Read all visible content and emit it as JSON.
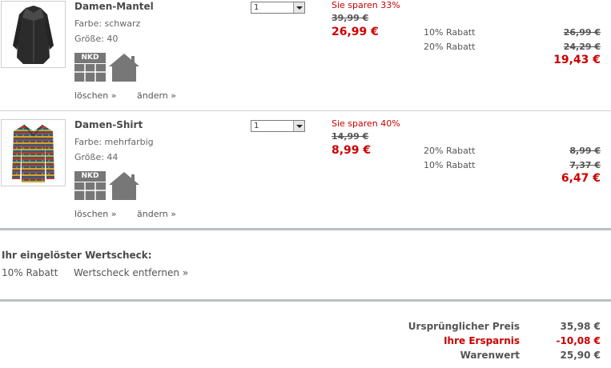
{
  "items": [
    {
      "name": "Damen-Mantel",
      "farbe": "Farbe: schwarz",
      "groesse": "Größe: 40",
      "qty": "1",
      "save_text": "Sie sparen 33%",
      "old_price": "39,99 €",
      "new_price": "26,99 €",
      "rabatte": [
        {
          "label": "10% Rabatt",
          "value": "26,99 €"
        },
        {
          "label": "20% Rabatt",
          "value": "24,29 €"
        }
      ],
      "final_price": "19,43 €",
      "nkd_label": "NKD",
      "delete_link": "löschen »",
      "change_link": "ändern »",
      "thumb_color": "#2e2e2e"
    },
    {
      "name": "Damen-Shirt",
      "farbe": "Farbe: mehrfarbig",
      "groesse": "Größe: 44",
      "qty": "1",
      "save_text": "Sie sparen 40%",
      "old_price": "14,99 €",
      "new_price": "8,99 €",
      "rabatte": [
        {
          "label": "20% Rabatt",
          "value": "8,99 €"
        },
        {
          "label": "10% Rabatt",
          "value": "7,37 €"
        }
      ],
      "final_price": "6,47 €",
      "nkd_label": "NKD",
      "delete_link": "löschen »",
      "change_link": "ändern »",
      "thumb_color": "#3a5a7a"
    }
  ],
  "voucher": {
    "heading": "Ihr eingelöster Wertscheck:",
    "value": "10% Rabatt",
    "remove_link": "Wertscheck entfernen »"
  },
  "summary": {
    "original_label": "Ursprünglicher Preis",
    "original_value": "35,98 €",
    "savings_label": "Ihre Ersparnis",
    "savings_value": "-10,08 €",
    "total_label": "Warenwert",
    "total_value": "25,90 €"
  },
  "colors": {
    "accent_red": "#cc0000",
    "text_gray": "#555555",
    "icon_gray": "#777777",
    "divider": "#b8c2c2"
  }
}
